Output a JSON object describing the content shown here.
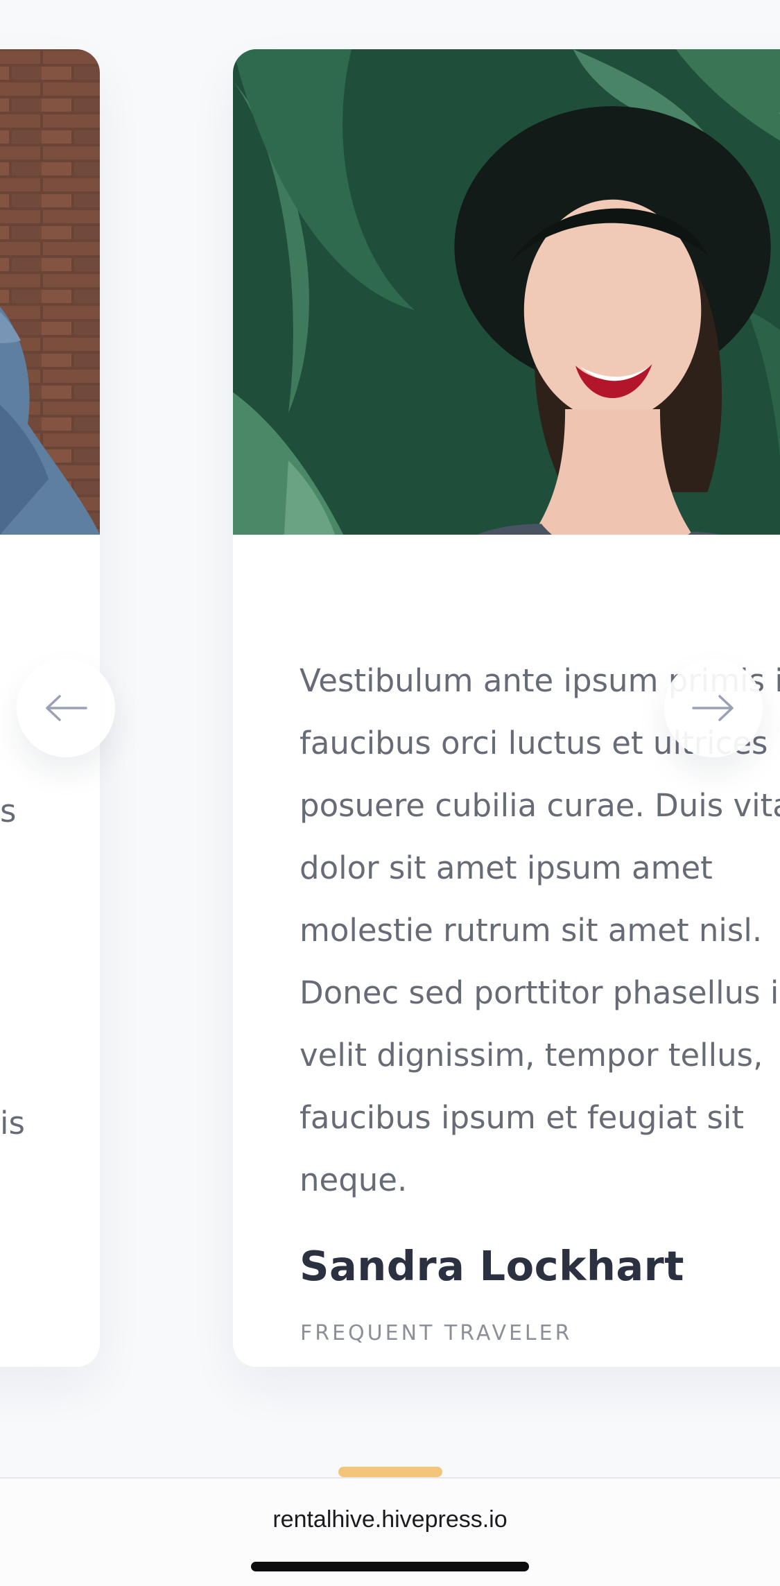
{
  "testimonials": [
    {
      "quote_fragments": [
        "s",
        "is"
      ]
    },
    {
      "quote": "Vestibulum ante ipsum primis in\nfaucibus orci luctus et ultrices\nposuere cubilia curae. Duis vitae\ndolor sit amet ipsum amet\nmolestie rutrum sit amet nisl.\nDonec sed porttitor phasellus in\nvelit dignissim, tempor tellus,\nfaucibus ipsum et feugiat sit\nneque.",
      "name": "Sandra Lockhart",
      "role": "FREQUENT TRAVELER"
    }
  ],
  "navigation": {
    "prev_icon": "arrow-left-icon",
    "next_icon": "arrow-right-icon"
  },
  "pager": {
    "active_color": "#f3c57a"
  },
  "browser": {
    "url": "rentalhive.hivepress.io"
  }
}
